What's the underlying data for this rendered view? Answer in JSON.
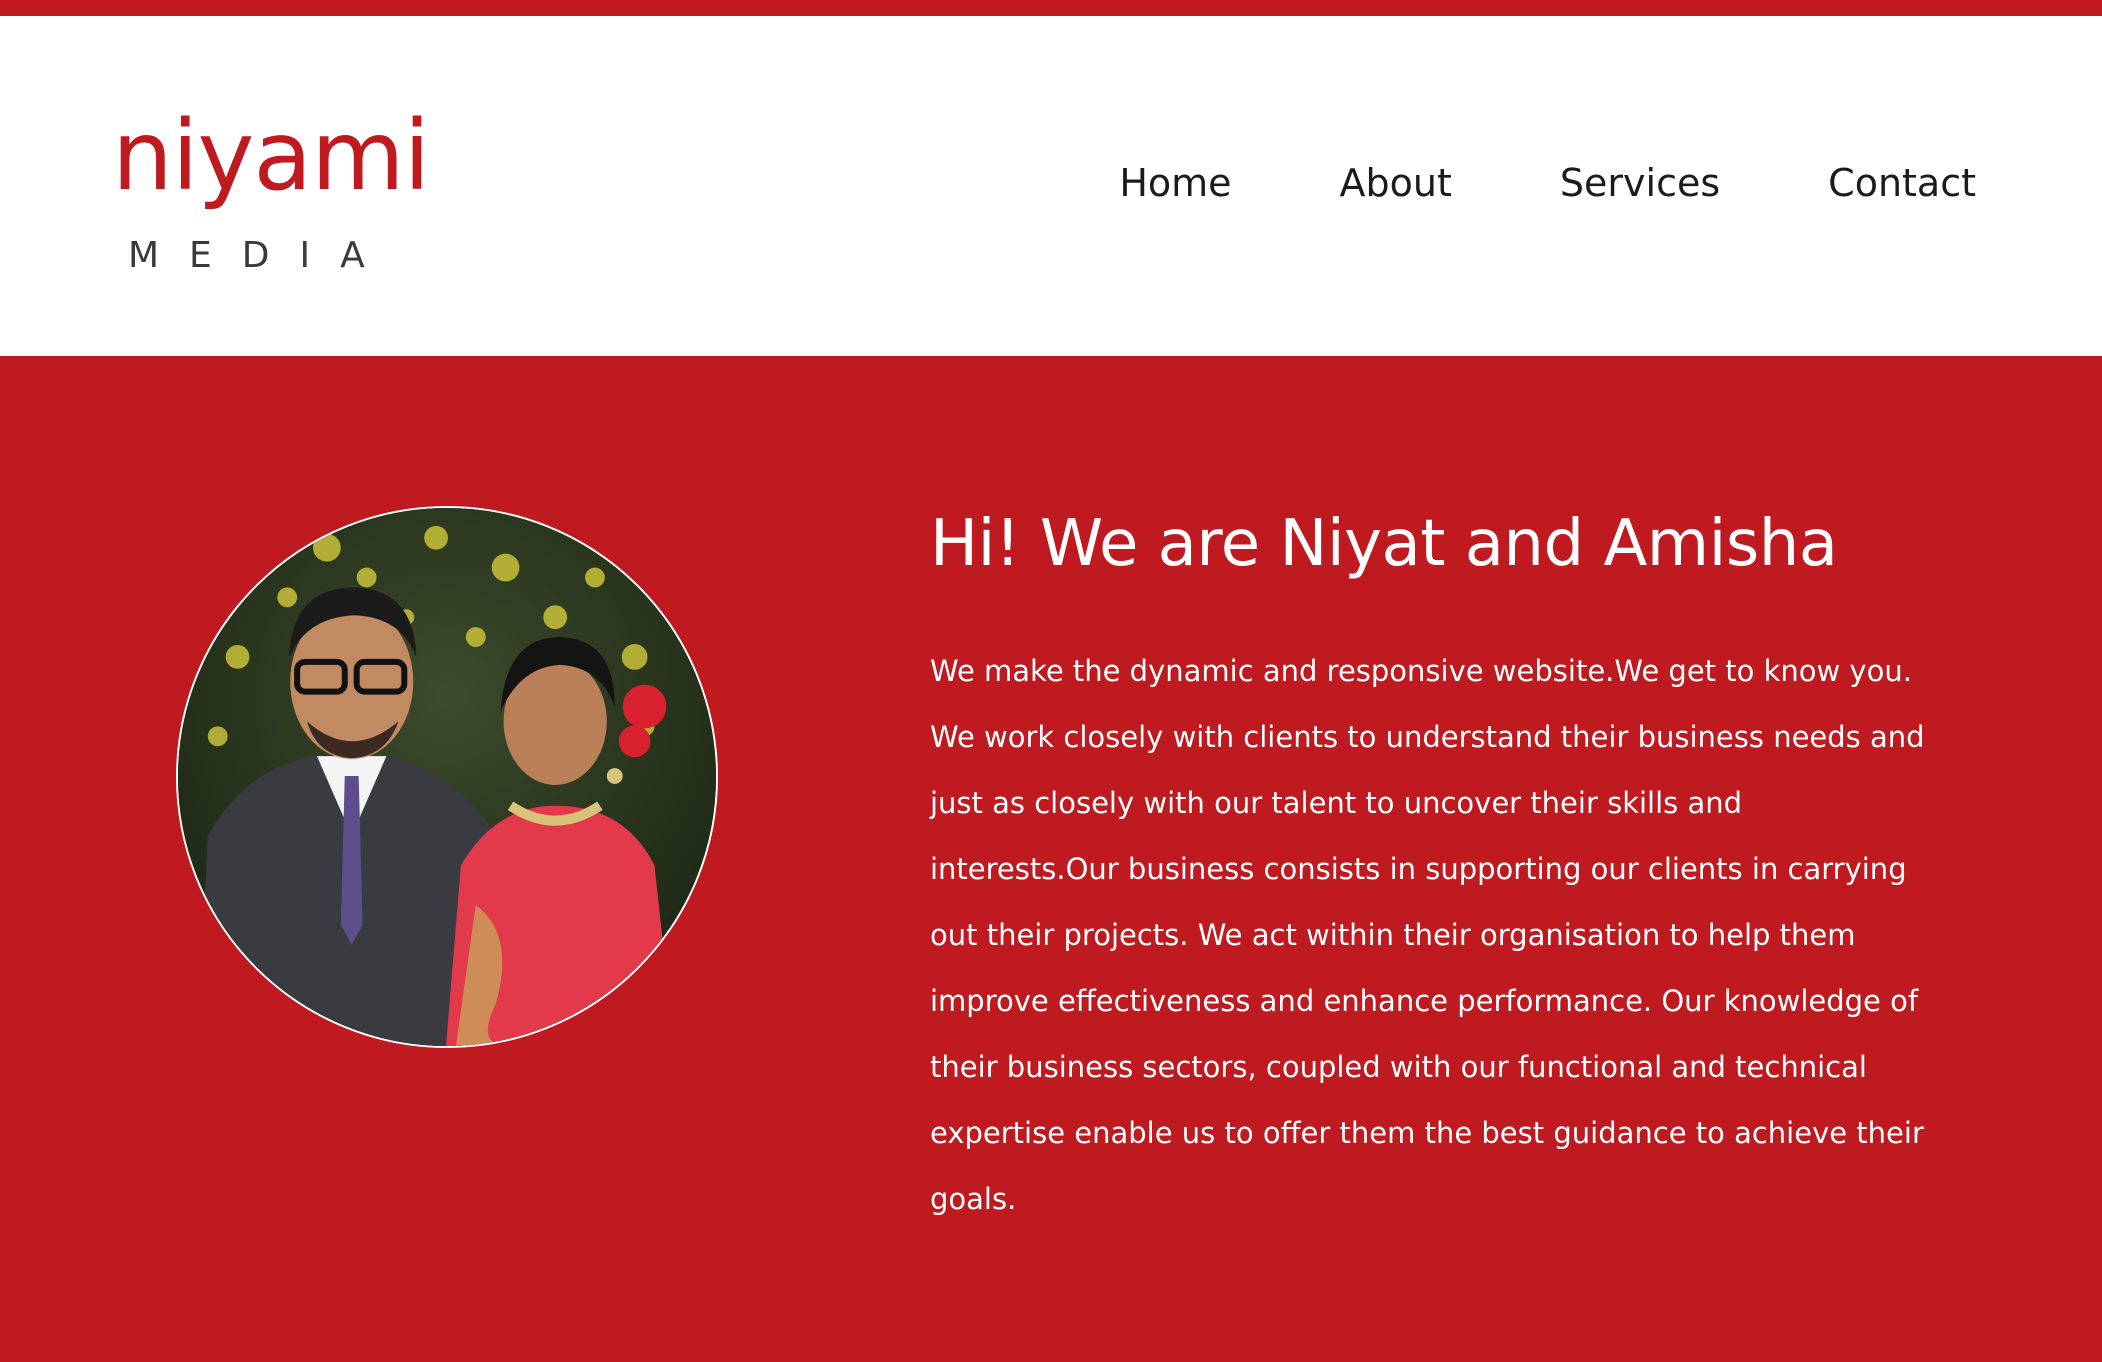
{
  "brand": {
    "logo_word": "niyami",
    "logo_sub": "MEDIA",
    "accent_color": "#be1a20"
  },
  "nav": {
    "items": [
      {
        "label": "Home"
      },
      {
        "label": "About"
      },
      {
        "label": "Services"
      },
      {
        "label": "Contact"
      }
    ]
  },
  "hero": {
    "title": "Hi! We are Niyat and Amisha",
    "body": "We make the dynamic and responsive website.We get to know you. We work closely with clients to understand their business needs and just as closely with our talent to uncover their skills and interests.Our business consists in supporting our clients in carrying out their projects. We act within their organisation to help them improve effectiveness and enhance performance. Our knowledge of their business sectors, coupled with our functional and technical expertise enable us to offer them the best guidance to achieve their goals.",
    "portrait_icon": "portrait-photo"
  }
}
